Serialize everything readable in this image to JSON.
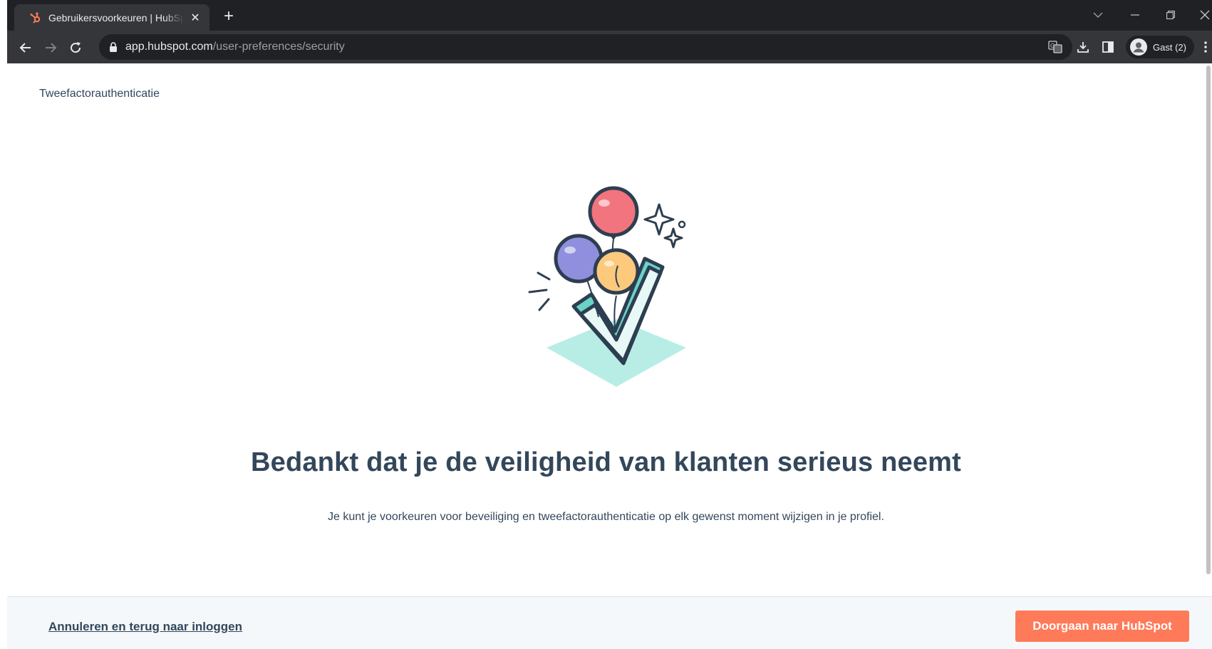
{
  "browser": {
    "tab_title": "Gebruikersvoorkeuren | HubSpot",
    "tab_close": "✕",
    "new_tab": "+",
    "url_domain": "app.hubspot.com",
    "url_path": "/user-preferences/security",
    "profile_name": "Gast (2)",
    "favicon_icon": "hubspot-sprocket-icon",
    "colors": {
      "chrome_dark": "#202124",
      "chrome_toolbar": "#35363a"
    }
  },
  "page": {
    "title": "Tweefactorauthenticatie",
    "heading": "Bedankt dat je de veiligheid van klanten serieus neemt",
    "subtext": "Je kunt je voorkeuren voor beveiliging en tweefactorauthenticatie op elk gewenst moment wijzigen in je profiel.",
    "illustration_icon": "balloons-checkmark-icon"
  },
  "footer": {
    "cancel_label": "Annuleren en terug naar inloggen",
    "continue_label": "Doorgaan naar HubSpot"
  },
  "colors": {
    "text": "#33475b",
    "accent": "#ff7a59",
    "footer_bg": "#f5f8fa"
  }
}
